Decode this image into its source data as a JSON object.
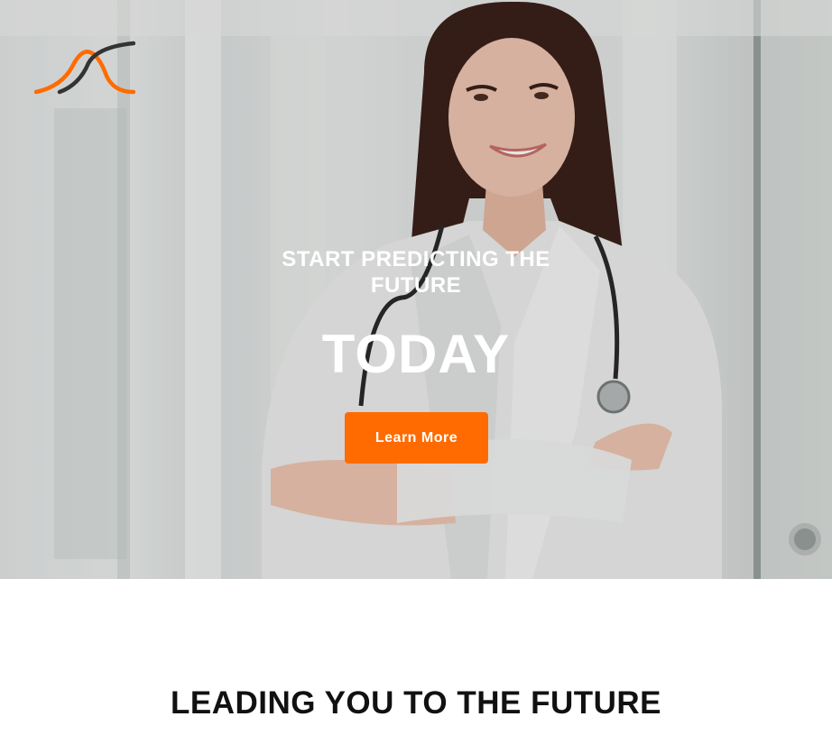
{
  "hero": {
    "subtitle_line1": "START PREDICTING THE",
    "subtitle_line2": "FUTURE",
    "headline": "TODAY",
    "cta_label": "Learn More",
    "photo_description_icon": "doctor-photo"
  },
  "section": {
    "title": "LEADING YOU TO THE FUTURE"
  },
  "colors": {
    "accent": "#ff6b00",
    "logo_dark": "#333333",
    "heading": "#111111"
  }
}
